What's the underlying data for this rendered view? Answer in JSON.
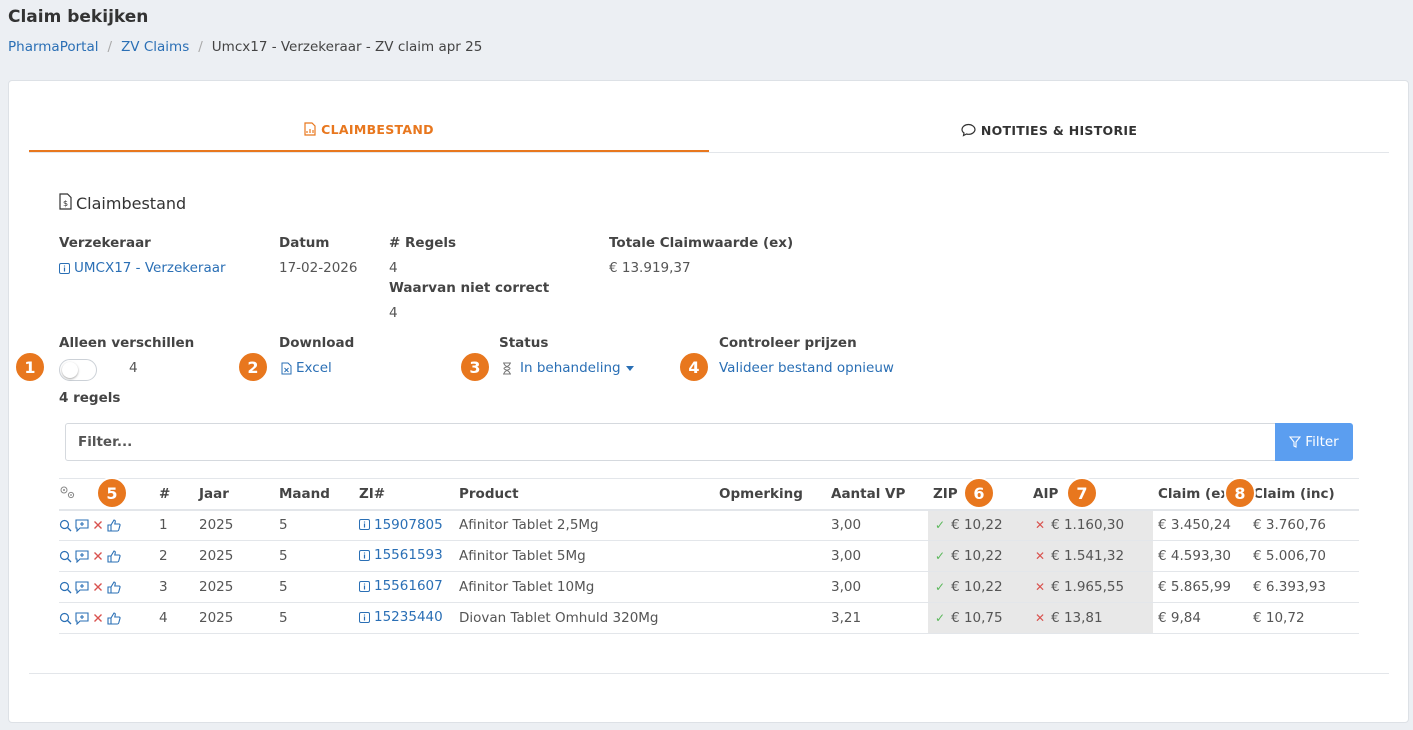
{
  "page": {
    "title": "Claim bekijken",
    "breadcrumb": [
      "PharmaPortal",
      "ZV Claims",
      "Umcx17 - Verzekeraar - ZV claim apr 25"
    ]
  },
  "tabs": [
    {
      "label": "CLAIMBESTAND",
      "icon": "file-chart-icon",
      "active": true
    },
    {
      "label": "NOTITIES & HISTORIE",
      "icon": "chat-bubble-icon",
      "active": false
    }
  ],
  "section": {
    "title": "Claimbestand",
    "icon": "file-dollar-icon"
  },
  "info": {
    "verzekeraar_label": "Verzekeraar",
    "verzekeraar_value": "UMCX17 - Verzekeraar",
    "datum_label": "Datum",
    "datum_value": "17-02-2026",
    "regels_label": "# Regels",
    "regels_value": "4",
    "niet_correct_label": "Waarvan niet correct",
    "niet_correct_value": "4",
    "totale_label": "Totale Claimwaarde (ex)",
    "totale_value": "€ 13.919,37"
  },
  "controls": {
    "alleen_label": "Alleen verschillen",
    "alleen_count": "4",
    "toggle_on": false,
    "regels_summary": "4 regels",
    "download_label": "Download",
    "download_link": "Excel",
    "status_label": "Status",
    "status_value": "In behandeling",
    "controleer_label": "Controleer prijzen",
    "controleer_link": "Valideer bestand opnieuw"
  },
  "badges": [
    "1",
    "2",
    "3",
    "4",
    "5",
    "6",
    "7",
    "8"
  ],
  "filter": {
    "placeholder": "Filter...",
    "button": "Filter"
  },
  "table": {
    "headers": {
      "nr": "#",
      "jaar": "Jaar",
      "maand": "Maand",
      "zi": "ZI#",
      "product": "Product",
      "opmerking": "Opmerking",
      "aantal": "Aantal VP",
      "zip": "ZIP",
      "aip": "AIP",
      "claim_ex": "Claim (ex)",
      "claim_inc": "Claim (inc)"
    },
    "rows": [
      {
        "nr": "1",
        "jaar": "2025",
        "maand": "5",
        "zi": "15907805",
        "product": "Afinitor Tablet 2,5Mg",
        "opmerking": "",
        "aantal": "3,00",
        "zip": "€ 10,22",
        "zip_ok": true,
        "aip": "€ 1.160,30",
        "aip_ok": false,
        "claim_ex": "€ 3.450,24",
        "claim_inc": "€ 3.760,76"
      },
      {
        "nr": "2",
        "jaar": "2025",
        "maand": "5",
        "zi": "15561593",
        "product": "Afinitor Tablet 5Mg",
        "opmerking": "",
        "aantal": "3,00",
        "zip": "€ 10,22",
        "zip_ok": true,
        "aip": "€ 1.541,32",
        "aip_ok": false,
        "claim_ex": "€ 4.593,30",
        "claim_inc": "€ 5.006,70"
      },
      {
        "nr": "3",
        "jaar": "2025",
        "maand": "5",
        "zi": "15561607",
        "product": "Afinitor Tablet 10Mg",
        "opmerking": "",
        "aantal": "3,00",
        "zip": "€ 10,22",
        "zip_ok": true,
        "aip": "€ 1.965,55",
        "aip_ok": false,
        "claim_ex": "€ 5.865,99",
        "claim_inc": "€ 6.393,93"
      },
      {
        "nr": "4",
        "jaar": "2025",
        "maand": "5",
        "zi": "15235440",
        "product": "Diovan Tablet Omhuld 320Mg",
        "opmerking": "",
        "aantal": "3,21",
        "zip": "€ 10,75",
        "zip_ok": true,
        "aip": "€ 13,81",
        "aip_ok": false,
        "claim_ex": "€ 9,84",
        "claim_inc": "€ 10,72"
      }
    ]
  },
  "colors": {
    "accent": "#e8771e",
    "link": "#2a6fb5",
    "button": "#5b9ef0",
    "ok": "#5bb85b",
    "error": "#d9534f"
  }
}
